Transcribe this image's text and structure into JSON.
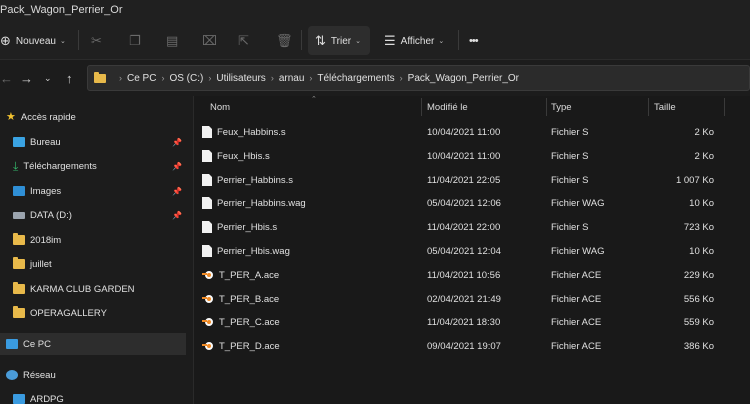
{
  "window": {
    "title": "Pack_Wagon_Perrier_Or"
  },
  "toolbar": {
    "new_label": "Nouveau",
    "sort_label": "Trier",
    "view_label": "Afficher",
    "more_label": "•••"
  },
  "address": {
    "crumbs": [
      "Ce PC",
      "OS (C:)",
      "Utilisateurs",
      "arnau",
      "Téléchargements",
      "Pack_Wagon_Perrier_Or"
    ]
  },
  "sidebar": {
    "items": [
      {
        "label": "Accès rapide"
      },
      {
        "label": "Bureau"
      },
      {
        "label": "Téléchargements"
      },
      {
        "label": "Images"
      },
      {
        "label": "DATA (D:)"
      },
      {
        "label": "2018im"
      },
      {
        "label": "juillet"
      },
      {
        "label": "KARMA CLUB GARDEN"
      },
      {
        "label": "OPERAGALLERY"
      },
      {
        "label": "Ce PC"
      },
      {
        "label": "Réseau"
      },
      {
        "label": "ARDPG"
      }
    ]
  },
  "columns": {
    "name": "Nom",
    "modified": "Modifié le",
    "type": "Type",
    "size": "Taille"
  },
  "files": [
    {
      "name": "Feux_Habbins.s",
      "modified": "10/04/2021 11:00",
      "type": "Fichier S",
      "size": "2 Ko",
      "icon": "file-icon"
    },
    {
      "name": "Feux_Hbis.s",
      "modified": "10/04/2021 11:00",
      "type": "Fichier S",
      "size": "2 Ko",
      "icon": "file-icon"
    },
    {
      "name": "Perrier_Habbins.s",
      "modified": "11/04/2021 22:05",
      "type": "Fichier S",
      "size": "1 007 Ko",
      "icon": "file-icon"
    },
    {
      "name": "Perrier_Habbins.wag",
      "modified": "05/04/2021 12:06",
      "type": "Fichier WAG",
      "size": "10 Ko",
      "icon": "file-icon"
    },
    {
      "name": "Perrier_Hbis.s",
      "modified": "11/04/2021 22:00",
      "type": "Fichier S",
      "size": "723 Ko",
      "icon": "file-icon"
    },
    {
      "name": "Perrier_Hbis.wag",
      "modified": "05/04/2021 12:04",
      "type": "Fichier WAG",
      "size": "10 Ko",
      "icon": "file-icon"
    },
    {
      "name": "T_PER_A.ace",
      "modified": "11/04/2021 10:56",
      "type": "Fichier ACE",
      "size": "229 Ko",
      "icon": "blender-icon"
    },
    {
      "name": "T_PER_B.ace",
      "modified": "02/04/2021 21:49",
      "type": "Fichier ACE",
      "size": "556 Ko",
      "icon": "blender-icon"
    },
    {
      "name": "T_PER_C.ace",
      "modified": "11/04/2021 18:30",
      "type": "Fichier ACE",
      "size": "559 Ko",
      "icon": "blender-icon"
    },
    {
      "name": "T_PER_D.ace",
      "modified": "09/04/2021 19:07",
      "type": "Fichier ACE",
      "size": "386 Ko",
      "icon": "blender-icon"
    }
  ]
}
